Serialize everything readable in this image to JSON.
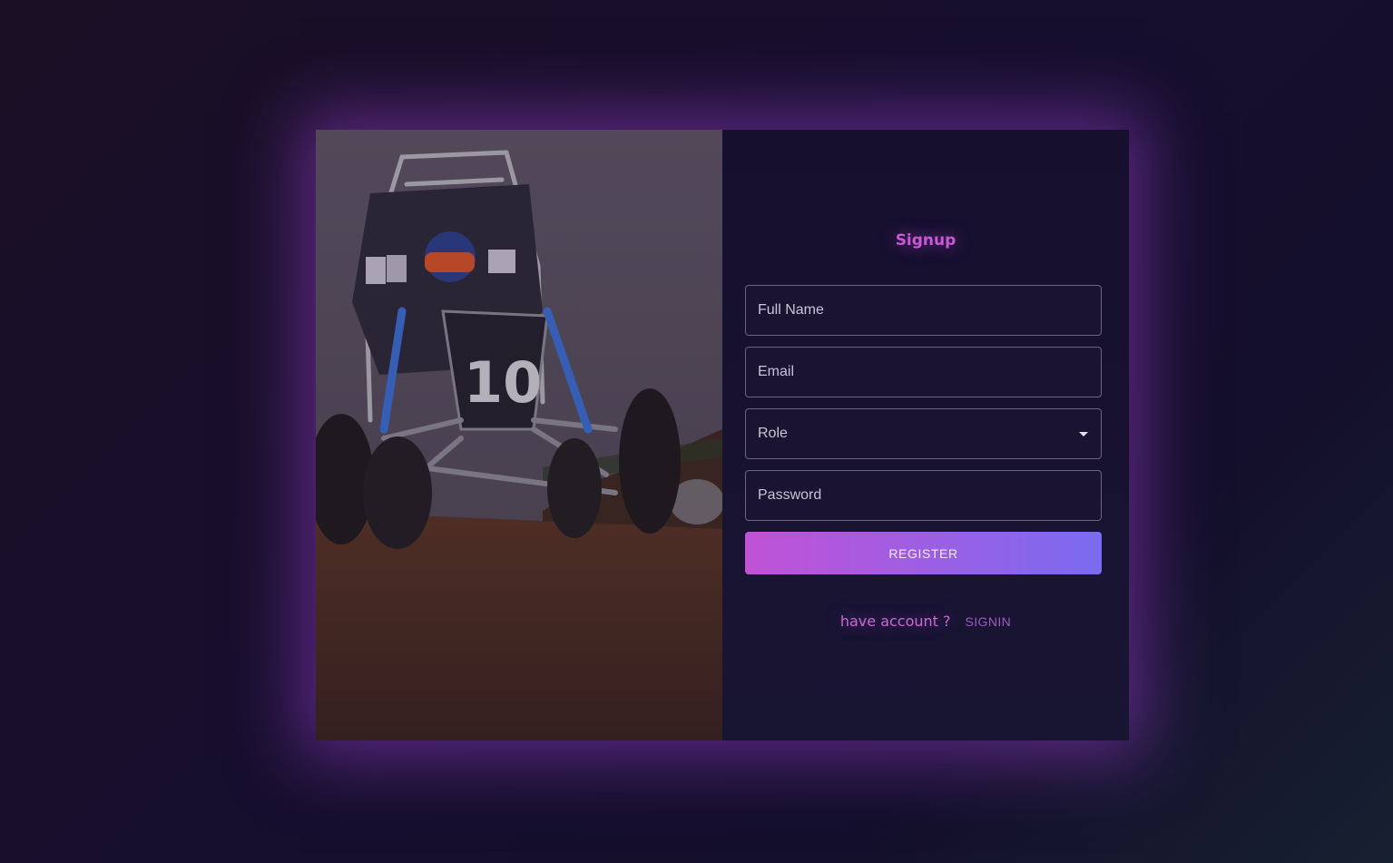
{
  "signup": {
    "title": "Signup",
    "fields": {
      "full_name_placeholder": "Full Name",
      "email_placeholder": "Email",
      "role_placeholder": "Role",
      "password_placeholder": "Password"
    },
    "register_label": "REGISTER",
    "have_account_text": "have account ?",
    "signin_label": "SIGNIN"
  },
  "photo": {
    "car_number": "10"
  },
  "colors": {
    "accent": "#c759d6",
    "button_start": "#c152d6",
    "button_end": "#7a6bf0",
    "glow": "#963cc8"
  }
}
